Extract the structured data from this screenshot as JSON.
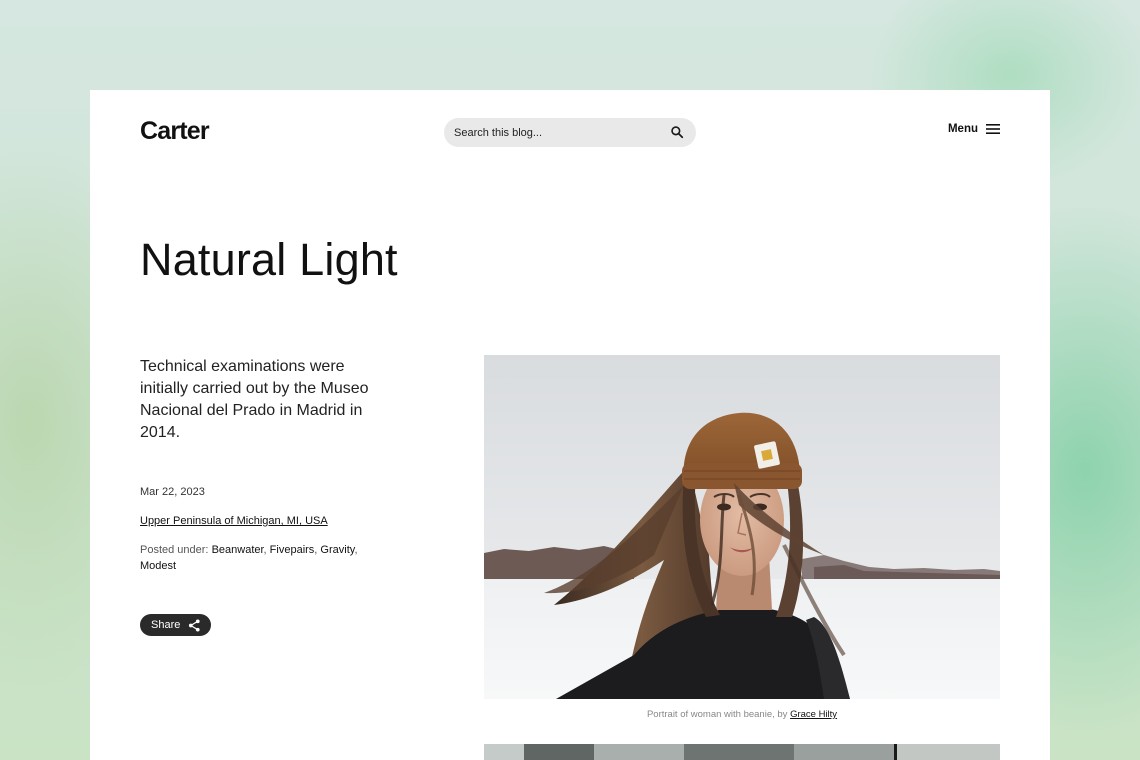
{
  "header": {
    "logo": "Carter",
    "search_placeholder": "Search this blog...",
    "search_icon": "search-icon",
    "menu_label": "Menu",
    "menu_icon": "hamburger-menu-icon"
  },
  "post": {
    "title": "Natural Light",
    "lede": "Technical examinations were initially carried out by the Museo Nacional del Prado in Madrid in 2014.",
    "date": "Mar 22, 2023",
    "location": "Upper Peninsula of Michigan, MI, USA",
    "posted_under_label": "Posted under:",
    "tags": [
      "Beanwater",
      "Fivepairs",
      "Gravity",
      "Modest"
    ],
    "share_label": "Share",
    "share_icon": "share-icon"
  },
  "figure": {
    "caption_text": "Portrait of woman with beanie, by",
    "caption_credit": "Grace Hilty"
  },
  "colors": {
    "page_background": "#d5e7e0",
    "card_background": "#ffffff",
    "search_background": "#e9e9e9",
    "share_background": "#2a2a2a",
    "text": "#111111"
  }
}
